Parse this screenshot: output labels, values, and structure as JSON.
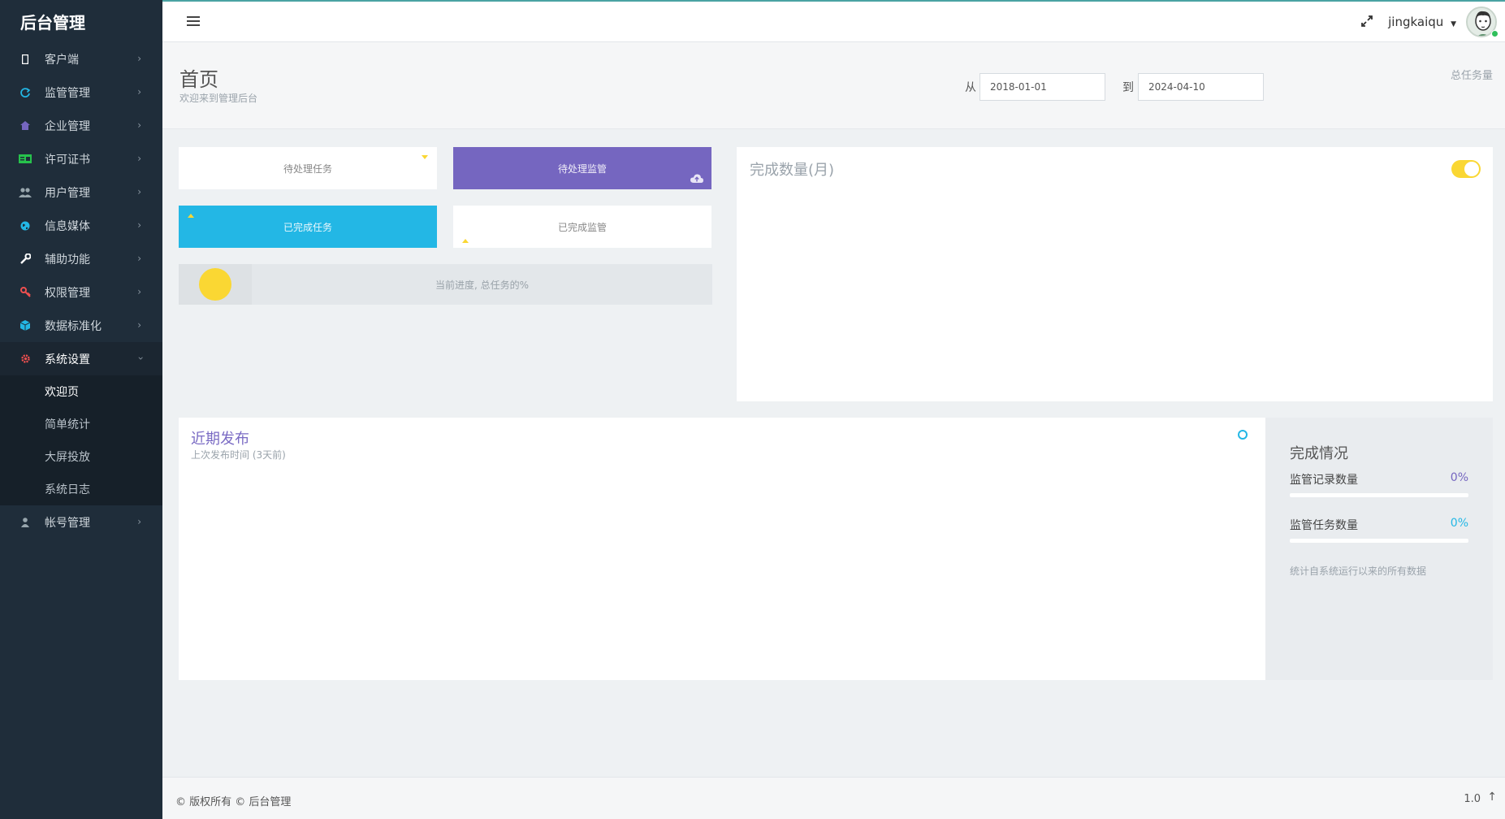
{
  "sidebar": {
    "brand": "后台管理",
    "items": [
      {
        "label": "客户端",
        "icon": "mobile-icon",
        "color": "#ffffff"
      },
      {
        "label": "监管管理",
        "icon": "refresh-icon",
        "color": "#23b7e5"
      },
      {
        "label": "企业管理",
        "icon": "home-icon",
        "color": "#7566c0"
      },
      {
        "label": "许可证书",
        "icon": "certificate-icon",
        "color": "#27c24c"
      },
      {
        "label": "用户管理",
        "icon": "users-icon",
        "color": "#98a6ad"
      },
      {
        "label": "信息媒体",
        "icon": "globe-icon",
        "color": "#23b7e5"
      },
      {
        "label": "辅助功能",
        "icon": "wrench-icon",
        "color": "#ffffff"
      },
      {
        "label": "权限管理",
        "icon": "key-icon",
        "color": "#f05050"
      },
      {
        "label": "数据标准化",
        "icon": "cube-icon",
        "color": "#23b7e5"
      },
      {
        "label": "系统设置",
        "icon": "gear-icon",
        "color": "#f05050"
      }
    ],
    "submenu": [
      "欢迎页",
      "简单统计",
      "大屏投放",
      "系统日志"
    ],
    "account": {
      "label": "帐号管理",
      "icon": "user-icon"
    }
  },
  "header": {
    "username": "jingkaiqu"
  },
  "page": {
    "title": "首页",
    "subtitle": "欢迎来到管理后台",
    "from_label": "从",
    "from_date": "2018-01-01",
    "to_label": "到",
    "to_date": "2024-04-10",
    "total_label": "总任务量"
  },
  "tiles": {
    "pending_tasks": "待处理任务",
    "pending_supervision": "待处理监管",
    "completed_tasks": "已完成任务",
    "completed_supervision": "已完成监管",
    "progress_text": "当前进度, 总任务的%"
  },
  "chart": {
    "title": "完成数量(月)",
    "toggle_on": true
  },
  "recent": {
    "title": "近期发布",
    "subtitle": "上次发布时间 (3天前)"
  },
  "stats": {
    "title": "完成情况",
    "rows": [
      {
        "label": "监管记录数量",
        "value": "0%",
        "color": "#7566c0"
      },
      {
        "label": "监管任务数量",
        "value": "0%",
        "color": "#23b7e5"
      }
    ],
    "note": "统计自系统运行以来的所有数据"
  },
  "footer": {
    "copyright": "© 版权所有 © 后台管理",
    "version": "1.0",
    "up_icon": "↑"
  }
}
